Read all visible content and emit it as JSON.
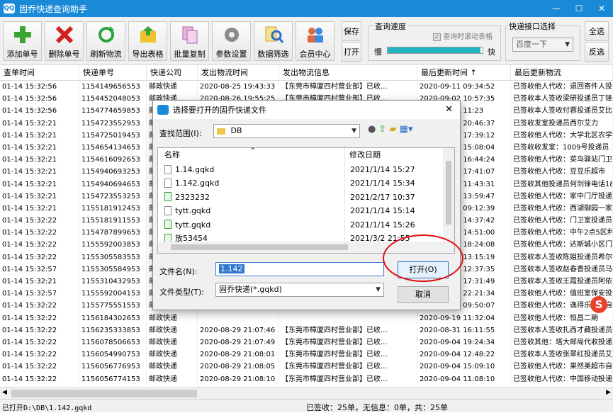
{
  "window": {
    "title": "固乔快递查询助手",
    "app_icon": "QQ"
  },
  "toolbar": {
    "buttons": [
      {
        "label": "添加单号",
        "icon": "add-icon"
      },
      {
        "label": "删除单号",
        "icon": "delete-icon"
      },
      {
        "label": "刷新物流",
        "icon": "refresh-icon"
      },
      {
        "label": "导出表格",
        "icon": "export-icon"
      },
      {
        "label": "批量复制",
        "icon": "copy-icon"
      },
      {
        "label": "参数设置",
        "icon": "gear-icon"
      },
      {
        "label": "数据筛选",
        "icon": "filter-icon"
      },
      {
        "label": "会员中心",
        "icon": "members-icon"
      }
    ],
    "save_label": "保存",
    "open_label": "打开",
    "speed_group_label": "查询速度",
    "auto_scroll_label": "查询时滚动表格",
    "slow_label": "慢",
    "fast_label": "快",
    "speed_percent": 98,
    "api_group_label": "快递接口选择",
    "api_value": "百度一下",
    "select_all_label": "全选",
    "invert_label": "反选"
  },
  "grid": {
    "columns": [
      "查单时间",
      "快递单号",
      "快递公司",
      "发出物流时间",
      "发出物流信息",
      "最后更新时间 ↑",
      "最后更新物流"
    ],
    "rows": [
      [
        "01-14 15:32:56",
        "1154149656553",
        "邮政快递",
        "2020-08-25 19:43:33",
        "【东莞市樟厦四村营业部】已收...",
        "2020-09-11 09:34:52",
        "已签收他人代收：退回寄件人投"
      ],
      [
        "01-14 15:32:56",
        "1154452048053",
        "邮政快递",
        "2020-08-26 19:55:25",
        "【东莞市樟厦四村营业部】已收...",
        "2020-09-02 10:57:35",
        "已签收本人签收梁研投递员丁锋"
      ],
      [
        "01-14 15:32:56",
        "1154774659853",
        "邮政快递",
        "",
        "",
        "2020-09-19 11:23",
        "已签收本人签收付蓉投递员艾比"
      ],
      [
        "01-14 15:32:21",
        "1154723552953",
        "邮政快递",
        "",
        "",
        "2020-09-19 20:46:37",
        "已签收发室投递员西尔艾力"
      ],
      [
        "01-14 15:32:21",
        "1154725019453",
        "邮政快递",
        "",
        "",
        "2020-09-19 17:39:12",
        "已签收他人代收：大学北区农学"
      ],
      [
        "01-14 15:32:21",
        "1154654134653",
        "邮政快递",
        "",
        "",
        "2020-09-19 15:08:04",
        "已签收收发室：1009号投递员"
      ],
      [
        "01-14 15:32:21",
        "1154616092653",
        "邮政快递",
        "",
        "",
        "2020-09-19 16:44:24",
        "已签收他人代收：菜鸟驿站门卫"
      ],
      [
        "01-14 15:32:21",
        "1154940693253",
        "邮政快递",
        "",
        "",
        "2020-09-19 17:41:07",
        "已签收他人代收：豆豆乐超市"
      ],
      [
        "01-14 15:32:21",
        "1154940694653",
        "邮政快递",
        "",
        "",
        "2020-09-19 11:43:31",
        "已签收其他投递员何剑锋电话18"
      ],
      [
        "01-14 15:32:21",
        "1154723553253",
        "邮政快递",
        "",
        "",
        "2020-09-19 13:59:47",
        "已签收他人代收：家中门厅投递"
      ],
      [
        "01-14 15:32:21",
        "1155181912453",
        "邮政快递",
        "",
        "",
        "2020-09-19 09:12:39",
        "已签收他人代收：西湖御园一家"
      ],
      [
        "01-14 15:32:22",
        "1155181911553",
        "邮政快递",
        "",
        "",
        "2020-09-19 14:37:42",
        "已签收他人代收：门卫室投递员"
      ],
      [
        "01-14 15:32:22",
        "1154787899653",
        "邮政快递",
        "",
        "",
        "2020-09-19 14:51:00",
        "已签收他人代收：中午2点5区利"
      ],
      [
        "01-14 15:32:22",
        "1155592003853",
        "邮政快递",
        "",
        "",
        "2020-09-19 18:24:08",
        "已签收他人代收：达斯城小区门"
      ],
      [
        "01-14 15:32:22",
        "1155305583553",
        "邮政快递",
        "",
        "",
        "2020-09-19 13:15:19",
        "已签收本人签收陈姐投递员希尔"
      ],
      [
        "01-14 15:32:57",
        "1155305584953",
        "邮政快递",
        "",
        "",
        "2020-09-19 12:37:35",
        "已签收本人签收赵春香投递员马"
      ],
      [
        "01-14 15:32:21",
        "1155310432953",
        "邮政快递",
        "",
        "",
        "2020-09-19 17:31:49",
        "已签收本人签收王霞投递员阿依"
      ],
      [
        "01-14 15:32:57",
        "1155592004153",
        "邮政快递",
        "",
        "",
        "2020-09-19 22:21:34",
        "已签收他人代收：值班室保安投"
      ],
      [
        "01-14 15:32:22",
        "1155775551553",
        "邮政快递",
        "",
        "",
        "2020-09-19 09:50:07",
        "已签收他人代收：逸得乐超市自"
      ],
      [
        "01-14 15:32:22",
        "1156184302653",
        "邮政快递",
        "",
        "",
        "2020-09-19 11:32:04",
        "已签收他人代收：恒昌二期"
      ],
      [
        "01-14 15:32:22",
        "1156235333853",
        "邮政快递",
        "2020-08-29 21:07:46",
        "【东莞市樟厦四村营业部】已收...",
        "2020-08-31 16:11:55",
        "已签收本人签收扎西才藏投递员"
      ],
      [
        "01-14 15:32:22",
        "1156078506653",
        "邮政快递",
        "2020-08-29 21:07:49",
        "【东莞市樟厦四村营业部】已收...",
        "2020-09-04 19:24:34",
        "已签收其他：塔大邮局代收投递"
      ],
      [
        "01-14 15:32:22",
        "1156054990753",
        "邮政快递",
        "2020-08-29 21:08:01",
        "【东莞市樟厦四村营业部】已收...",
        "2020-09-04 12:48:22",
        "已签收本人签收张翠红投递员艾"
      ],
      [
        "01-14 15:32:22",
        "1156056776953",
        "邮政快递",
        "2020-08-29 21:08:05",
        "【东莞市樟厦四村营业部】已收...",
        "2020-09-04 15:09:10",
        "已签收他人代收：果然美超市自"
      ],
      [
        "01-14 15:32:22",
        "1156056774153",
        "邮政快递",
        "2020-08-29 21:08:10",
        "【东莞市樟厦四村营业部】已收...",
        "2020-09-04 11:08:10",
        "已签收他人代收：中国移动投递"
      ]
    ]
  },
  "status": {
    "opened_file": "已打开D:\\DB\\1.142.gqkd",
    "summary": "已签收：25单，无信息：0单，共：25单"
  },
  "dialog": {
    "title": "选择要打开的固乔快递文件",
    "look_in_label": "查找范围(I):",
    "look_in_value": "DB",
    "col_name": "名称",
    "col_date": "修改日期",
    "files": [
      {
        "name": "1.14.gqkd",
        "date": "2021/1/14 15:27",
        "icon": "file-icon"
      },
      {
        "name": "1.142.gqkd",
        "date": "2021/1/14 15:34",
        "icon": "file-icon"
      },
      {
        "name": "2323232",
        "date": "2021/2/17 10:37",
        "icon": "app-file-icon"
      },
      {
        "name": "tytt.gqkd",
        "date": "2021/1/14 15:14",
        "icon": "file-icon"
      },
      {
        "name": "tytt.gqkd",
        "date": "2021/1/14 15:26",
        "icon": "app-file-icon"
      },
      {
        "name": "放53454",
        "date": "2021/3/2 21:55",
        "icon": "app-file-icon"
      }
    ],
    "filename_label": "文件名(N):",
    "filename_value": "1.142",
    "filetype_label": "文件类型(T):",
    "filetype_value": "固乔快递(*.gqkd)",
    "open_button": "打开(O)",
    "cancel_button": "取消"
  }
}
